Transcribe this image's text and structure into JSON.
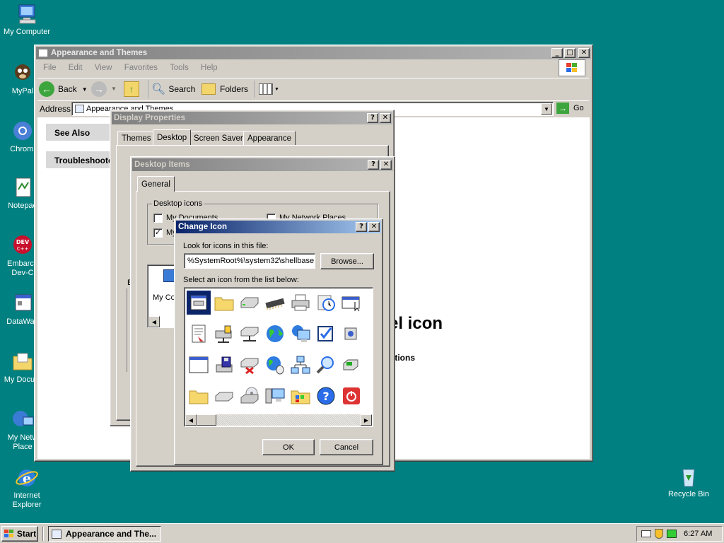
{
  "desktop": {
    "icons": [
      {
        "label": "My Computer"
      },
      {
        "label": "MyPal"
      },
      {
        "label": "Chromi"
      },
      {
        "label": "Notepad"
      },
      {
        "label": "Embarca Dev-C"
      },
      {
        "label": "DataWag"
      },
      {
        "label": "My Docum"
      },
      {
        "label": "My Netw Place"
      },
      {
        "label": "Internet Explorer"
      },
      {
        "label": "Recycle Bin"
      }
    ]
  },
  "explorer": {
    "title": "Appearance and Themes",
    "menu": [
      "File",
      "Edit",
      "View",
      "Favorites",
      "Tools",
      "Help"
    ],
    "toolbar": {
      "back": "Back",
      "search": "Search",
      "folders": "Folders"
    },
    "address_label": "Address",
    "address_value": "Appearance and Themes",
    "go": "Go",
    "see_also": "See Also",
    "troubleshoot": "Troubleshoote",
    "heading_fragment": "el icon",
    "options_fragment": "otions"
  },
  "display_props": {
    "title": "Display Properties",
    "tabs": [
      "Themes",
      "Desktop",
      "Screen Saver",
      "Appearance"
    ],
    "selected_tab": "Desktop",
    "frag_b": "E",
    "frag_c": "C"
  },
  "desktop_items": {
    "title": "Desktop Items",
    "tab": "General",
    "group_label": "Desktop icons",
    "cb1": "My Documents",
    "cb2": "My",
    "cb3": "My Network Places",
    "list_item": "My Com"
  },
  "change_icon": {
    "title": "Change Icon",
    "look_label": "Look for icons in this file:",
    "file_value": "%SystemRoot%\\system32\\shellbase",
    "browse": "Browse...",
    "select_label": "Select an icon from the list below:",
    "ok": "OK",
    "cancel": "Cancel"
  },
  "taskbar": {
    "start": "Start",
    "task": "Appearance and The...",
    "time": "6:27 AM"
  },
  "colors": {
    "desktop": "#008080",
    "face": "#d4d0c8",
    "title_active": "#0a246a",
    "title_inactive": "#808080"
  }
}
